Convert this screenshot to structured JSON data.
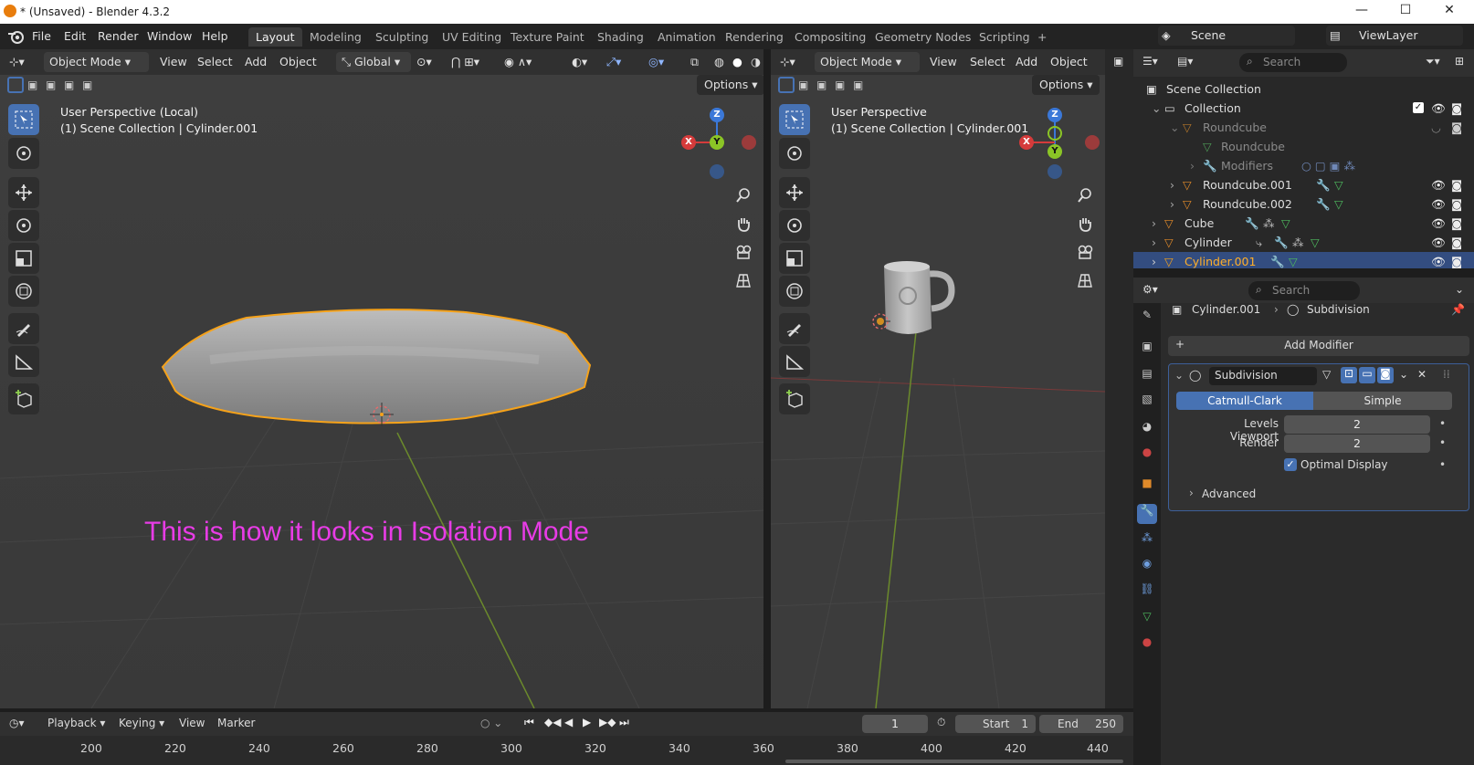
{
  "window": {
    "title": "* (Unsaved) - Blender 4.3.2",
    "minimize": "—",
    "maximize": "☐",
    "close": "✕"
  },
  "menu": {
    "items": [
      "File",
      "Edit",
      "Render",
      "Window",
      "Help"
    ]
  },
  "workspaces": {
    "tabs": [
      "Layout",
      "Modeling",
      "Sculpting",
      "UV Editing",
      "Texture Paint",
      "Shading",
      "Animation",
      "Rendering",
      "Compositing",
      "Geometry Nodes",
      "Scripting"
    ],
    "active": "Layout",
    "add": "+"
  },
  "scene": {
    "name": "Scene",
    "view_layer": "ViewLayer"
  },
  "left_viewport": {
    "mode": "Object Mode",
    "menus": [
      "View",
      "Select",
      "Add",
      "Object"
    ],
    "transform": "Global",
    "options": "Options",
    "perspective": "User Perspective (Local)",
    "collection_line": "(1) Scene Collection | Cylinder.001",
    "annotation": "This is how it looks in Isolation Mode"
  },
  "right_viewport": {
    "mode": "Object Mode",
    "menus": [
      "View",
      "Select",
      "Add",
      "Object"
    ],
    "options": "Options",
    "perspective": "User Perspective",
    "collection_line": "(1) Scene Collection | Cylinder.001"
  },
  "gizmo": {
    "x": "X",
    "y": "Y",
    "z": "Z"
  },
  "outliner": {
    "search_placeholder": "Search",
    "rows": [
      {
        "label": "Scene Collection"
      },
      {
        "label": "Collection"
      },
      {
        "label": "Roundcube"
      },
      {
        "label": "Roundcube"
      },
      {
        "label": "Modifiers"
      },
      {
        "label": "Roundcube.001"
      },
      {
        "label": "Roundcube.002"
      },
      {
        "label": "Cube"
      },
      {
        "label": "Cylinder"
      },
      {
        "label": "Cylinder.001"
      }
    ]
  },
  "properties": {
    "search_placeholder": "Search",
    "breadcrumb_object": "Cylinder.001",
    "breadcrumb_modifier": "Subdivision",
    "add_modifier": "Add Modifier",
    "modifier_name": "Subdivision",
    "mode_options": [
      "Catmull-Clark",
      "Simple"
    ],
    "mode_selected": "Catmull-Clark",
    "levels_viewport_label": "Levels Viewport",
    "levels_viewport_value": "2",
    "render_label": "Render",
    "render_value": "2",
    "optimal_display_label": "Optimal Display",
    "optimal_display_checked": true,
    "advanced_label": "Advanced"
  },
  "timeline": {
    "menus": [
      "Playback",
      "Keying",
      "View",
      "Marker"
    ],
    "current_frame": "1",
    "start_label": "Start",
    "start_value": "1",
    "end_label": "End",
    "end_value": "250",
    "ruler": [
      "200",
      "220",
      "240",
      "260",
      "280",
      "300",
      "320",
      "340",
      "360",
      "380",
      "400",
      "420",
      "440"
    ]
  },
  "colors": {
    "accent": "#4772b3",
    "selected_outline": "#f5a21a",
    "annotation": "#e83ce6",
    "selected_row": "#334d80"
  }
}
